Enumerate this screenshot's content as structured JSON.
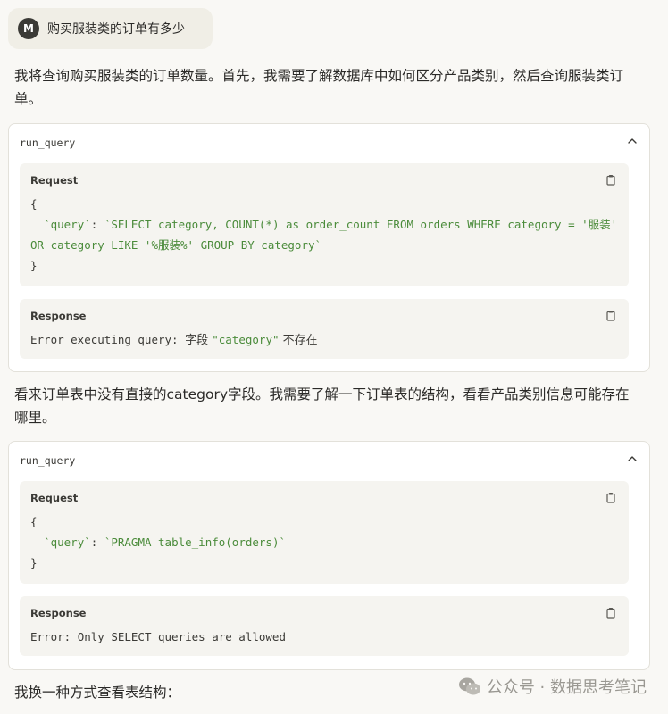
{
  "user_message": {
    "avatar_initial": "M",
    "text": "购买服装类的订单有多少"
  },
  "assistant": {
    "para1": "我将查询购买服装类的订单数量。首先，我需要了解数据库中如何区分产品类别，然后查询服装类订单。",
    "para2": "看来订单表中没有直接的category字段。我需要了解一下订单表的结构，看看产品类别信息可能存在哪里。",
    "para3": "我换一种方式查看表结构："
  },
  "tool_calls": [
    {
      "name": "run_query",
      "request_label": "Request",
      "response_label": "Response",
      "request": {
        "open": "{",
        "key": "`query`",
        "colon": ": ",
        "value_line1": "`SELECT category, COUNT(*) as order_count FROM orders WHERE category = '服装'",
        "value_line2": "OR category LIKE '%服装%' GROUP BY category`",
        "close": "}"
      },
      "response": {
        "prefix": "Error executing query: ",
        "cjk1": "字段 ",
        "quoted": "\"category\"",
        "cjk2": " 不存在"
      }
    },
    {
      "name": "run_query",
      "request_label": "Request",
      "response_label": "Response",
      "request": {
        "open": "{",
        "key": "`query`",
        "colon": ": ",
        "value_line1": "`PRAGMA table_info(orders)`",
        "close": "}"
      },
      "response": {
        "prefix": "Error: ",
        "message": "Only SELECT queries are allowed"
      }
    }
  ],
  "watermark": {
    "text": "公众号 · 数据思考笔记"
  },
  "icons": {
    "chevron": "chevron-up-icon",
    "copy": "copy-icon",
    "watermark": "wechat-icon"
  },
  "colors": {
    "string": "#4a8b3a",
    "panel_bg": "#f5f4f0",
    "bubble_bg": "#f0eee6"
  }
}
